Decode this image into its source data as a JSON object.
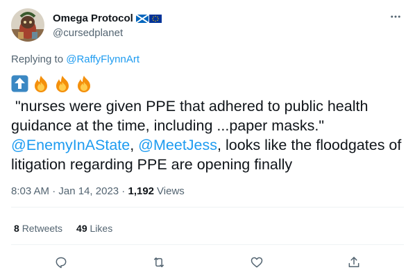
{
  "author": {
    "display_name": "Omega Protocol",
    "handle": "@cursedplanet",
    "flags": [
      "scotland-flag",
      "eu-flag"
    ]
  },
  "reply": {
    "prefix": "Replying to",
    "target": "@RaffyFlynnArt"
  },
  "tweet": {
    "emojis": [
      "up-arrow-icon",
      "fire-icon",
      "fire-icon",
      "fire-icon"
    ],
    "quote": " \"nurses were given PPE that adhered to public health guidance at the time, including ...paper masks.\"",
    "mention1": "@EnemyInAState",
    "separator": ", ",
    "mention2": "@MeetJess",
    "rest": ", looks like the floodgates of litigation regarding PPE are opening finally"
  },
  "meta": {
    "time": "8:03 AM",
    "dot": " · ",
    "date": "Jan 14, 2023",
    "views_dot": " · ",
    "views_count": "1,192",
    "views_label": "Views"
  },
  "stats": {
    "retweets_count": "8",
    "retweets_label": "Retweets",
    "likes_count": "49",
    "likes_label": "Likes"
  },
  "actions": [
    "reply-icon",
    "retweet-icon",
    "like-icon",
    "share-icon"
  ],
  "colors": {
    "link": "#1d9bf0",
    "secondary": "#536471",
    "primary": "#0f1419",
    "divider": "#eff3f4"
  }
}
